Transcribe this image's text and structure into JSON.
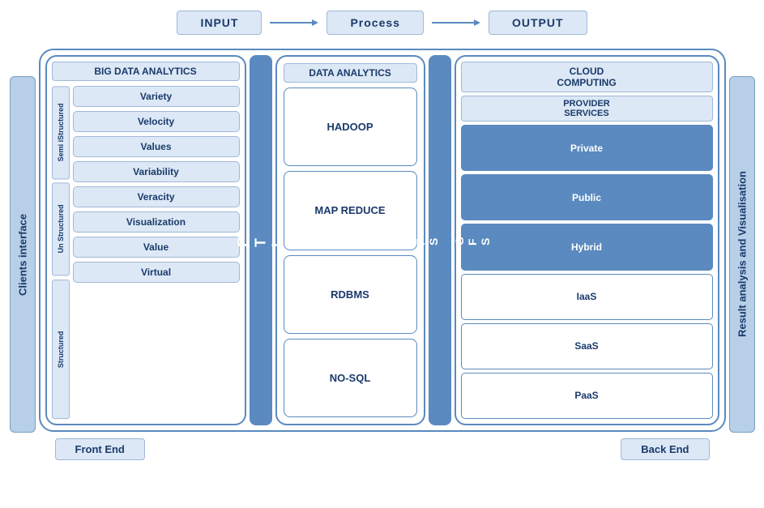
{
  "flow": {
    "input": "INPUT",
    "process": "Process",
    "output": "OUTPUT"
  },
  "clients_interface": "Clients interface",
  "result_analysis": "Result analysis and Visualisation",
  "big_data": {
    "title": "BIG DATA ANALYTICS",
    "groups": {
      "semi": "Semi iStructured",
      "un": "Un Structured",
      "structured": "Structured"
    },
    "items": [
      "Variety",
      "Velocity",
      "Values",
      "Variability",
      "Veracity",
      "Visualization",
      "Value",
      "Virtual"
    ]
  },
  "etl": "E\nT\nL",
  "data_analytics": {
    "title": "DATA ANALYTICS",
    "items": [
      "HADOOP",
      "MAP  REDUCE",
      "RDBMS",
      "NO-SQL"
    ]
  },
  "hdfs": "H\nD\nF\nS\n\nG\nF\nS",
  "cloud": {
    "title": "CLOUD\nCOMPUTING",
    "provider_title": "PROVIDER\nSERVICES",
    "items": [
      {
        "label": "Private",
        "dark": true
      },
      {
        "label": "Public",
        "dark": true
      },
      {
        "label": "Hybrid",
        "dark": true
      },
      {
        "label": "IaaS",
        "dark": false
      },
      {
        "label": "SaaS",
        "dark": false
      },
      {
        "label": "PaaS",
        "dark": false
      }
    ]
  },
  "bottom": {
    "front_end": "Front End",
    "back_end": "Back End"
  }
}
